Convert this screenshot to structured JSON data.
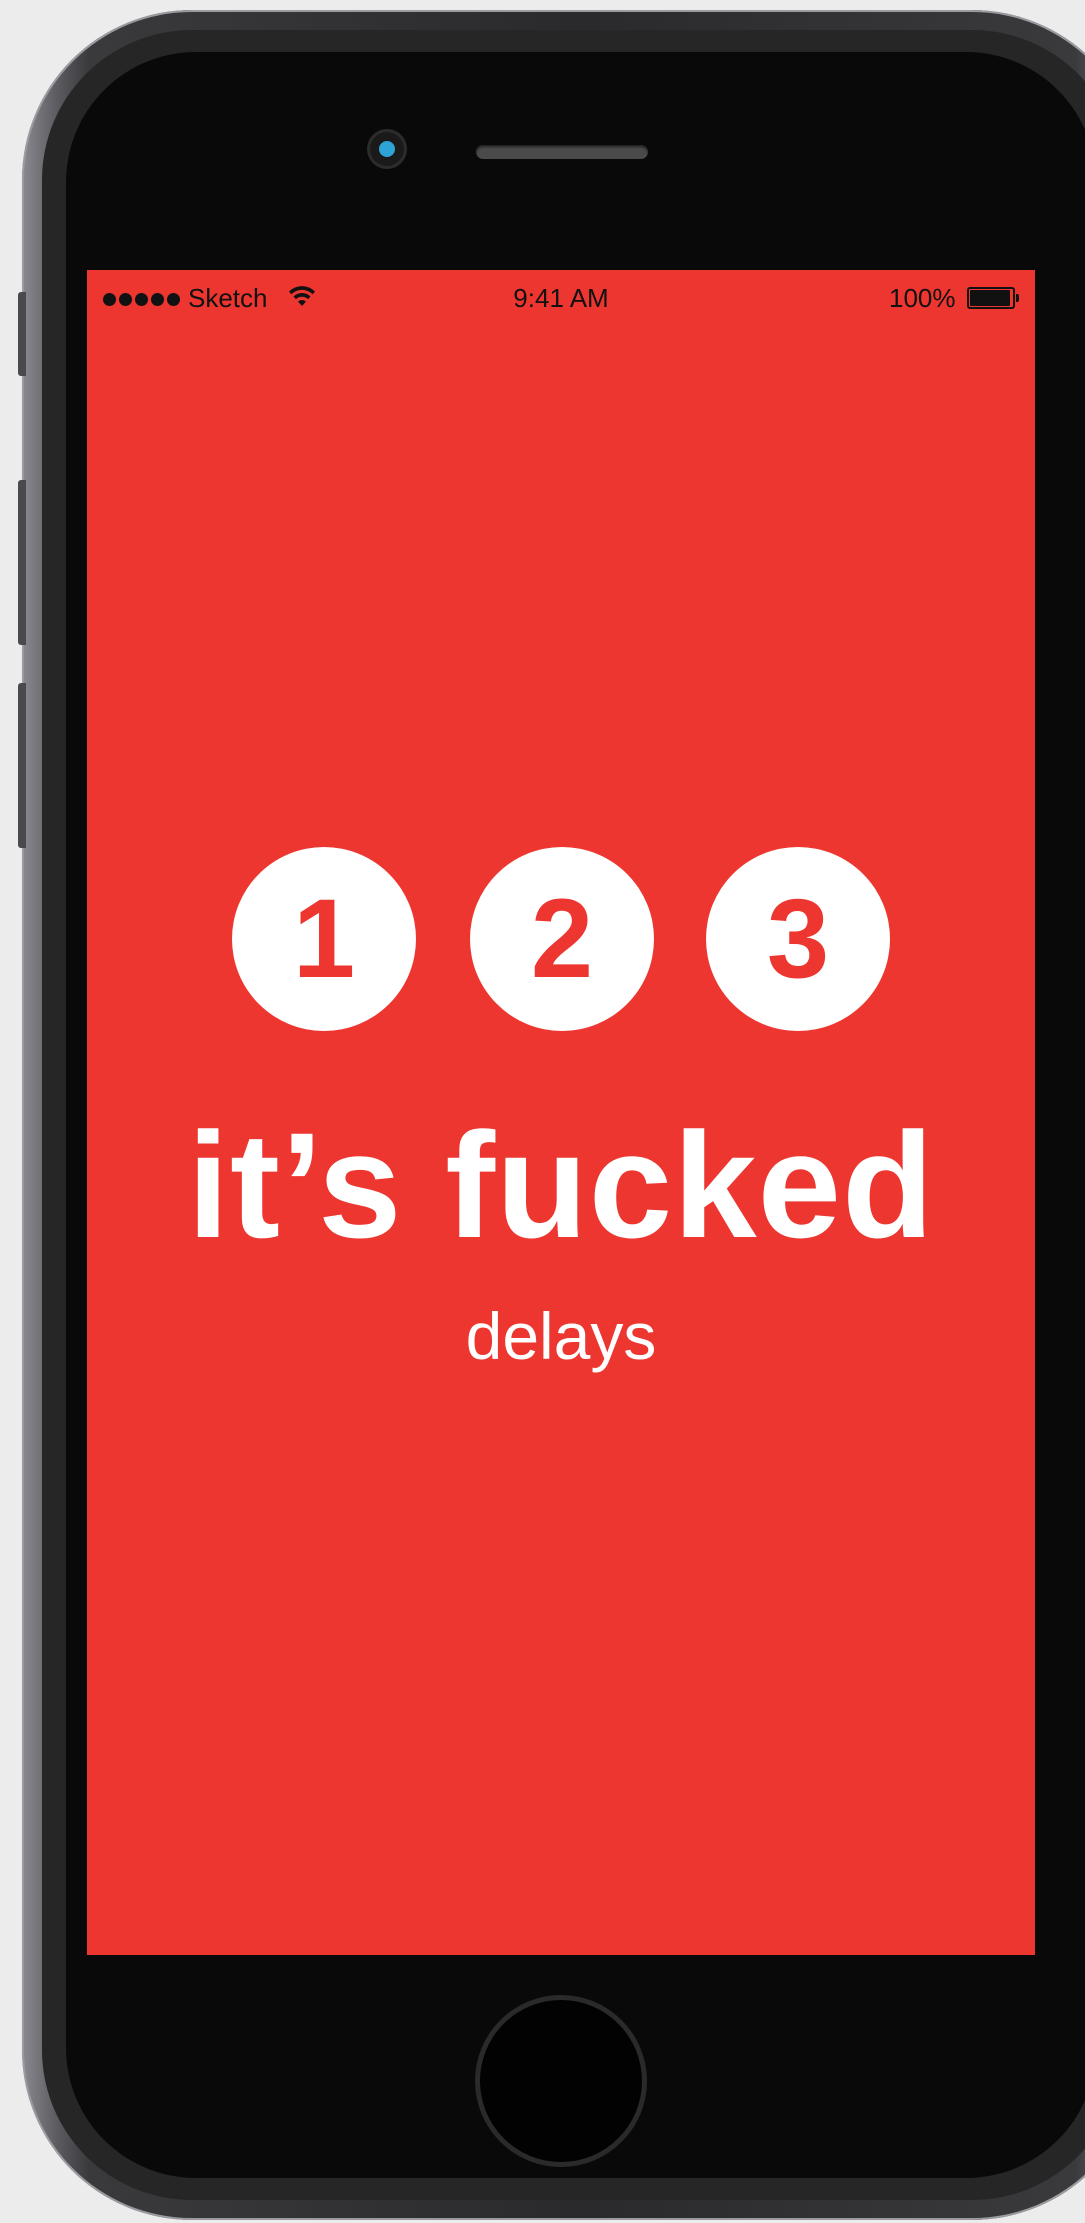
{
  "status_bar": {
    "carrier": "Sketch",
    "time": "9:41 AM",
    "battery_percent": "100%",
    "signal_bars": 5,
    "wifi_icon": "wifi-icon",
    "battery_icon": "battery-full-icon"
  },
  "routes": [
    {
      "label": "1"
    },
    {
      "label": "2"
    },
    {
      "label": "3"
    }
  ],
  "status": {
    "headline": "it’s fucked",
    "detail": "delays"
  },
  "colors": {
    "screen_background": "#ee3630",
    "bullet_fill": "#ffffff",
    "bullet_text": "#ee3630",
    "text": "#ffffff"
  }
}
